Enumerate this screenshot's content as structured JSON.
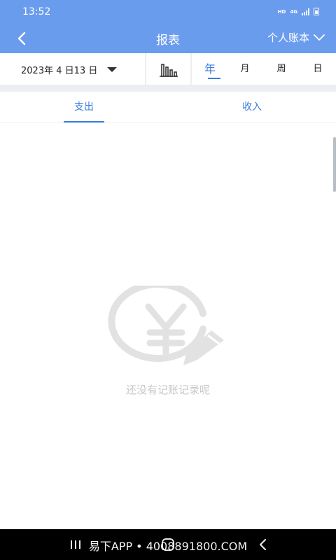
{
  "status_bar": {
    "time": "13:52",
    "hd": "HD",
    "network": "4G"
  },
  "header": {
    "title": "报表",
    "book_selector": "个人账本",
    "icons": {
      "back": "chevron-left-icon",
      "selector": "chevron-down-icon"
    }
  },
  "filter": {
    "date_year": "2023年",
    "date_month": "4",
    "date_day": "日13",
    "date_suffix": "日",
    "chart_icon": "bar-chart-icon",
    "periods": [
      "年",
      "月",
      "周",
      "日"
    ],
    "active_period": "年"
  },
  "type_tabs": {
    "items": [
      "支出",
      "收入"
    ],
    "active": "支出"
  },
  "empty_state": {
    "icon": "yen-pencil-icon",
    "message": "还没有记账记录呢"
  },
  "watermark": "易下APP • 4008891800.COM",
  "colors": {
    "primary": "#6a9cee",
    "accent": "#3b7fe0",
    "empty_gray": "#c7c7c7",
    "divider": "#eceef2"
  }
}
